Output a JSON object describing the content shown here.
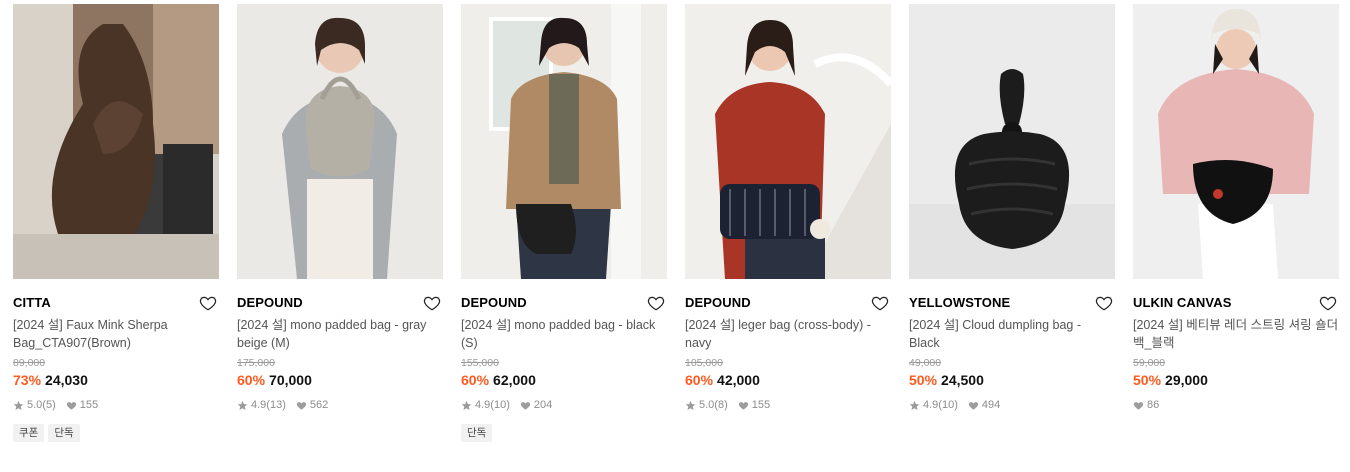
{
  "products": [
    {
      "brand": "CITTA",
      "title": "[2024 설] Faux Mink Sherpa Bag_CTA907(Brown)",
      "original_price": "89,000",
      "discount": "73%",
      "price": "24,030",
      "rating": "5.0",
      "review_count": "(5)",
      "likes": "155",
      "tags": [
        "쿠폰",
        "단독"
      ],
      "image": {
        "bg": "#c9b8a8",
        "accent": "#4a3426",
        "icon": "fur-bag-photo"
      }
    },
    {
      "brand": "DEPOUND",
      "title": "[2024 설] mono padded bag - gray beige (M)",
      "original_price": "175,000",
      "discount": "60%",
      "price": "70,000",
      "rating": "4.9",
      "review_count": "(13)",
      "likes": "562",
      "tags": [],
      "image": {
        "bg": "#e9e6e2",
        "accent": "#9a9a9a",
        "icon": "padded-bag-photo"
      }
    },
    {
      "brand": "DEPOUND",
      "title": "[2024 설] mono padded bag - black (S)",
      "original_price": "155,000",
      "discount": "60%",
      "price": "62,000",
      "rating": "4.9",
      "review_count": "(10)",
      "likes": "204",
      "tags": [
        "단독"
      ],
      "image": {
        "bg": "#ecebe8",
        "accent": "#b08a64",
        "icon": "padded-bag-photo"
      }
    },
    {
      "brand": "DEPOUND",
      "title": "[2024 설] leger bag (cross-body) - navy",
      "original_price": "105,000",
      "discount": "60%",
      "price": "42,000",
      "rating": "5.0",
      "review_count": "(8)",
      "likes": "155",
      "tags": [],
      "image": {
        "bg": "#f2f0ee",
        "accent": "#b23a2a",
        "icon": "crossbody-bag-photo"
      }
    },
    {
      "brand": "YELLOWSTONE",
      "title": "[2024 설] Cloud dumpling bag - Black",
      "original_price": "49,000",
      "discount": "50%",
      "price": "24,500",
      "rating": "4.9",
      "review_count": "(10)",
      "likes": "494",
      "tags": [],
      "image": {
        "bg": "#ededed",
        "accent": "#1c1c1c",
        "icon": "dumpling-bag-photo"
      }
    },
    {
      "brand": "ULKIN CANVAS",
      "title": "[2024 설] 베티뷰 레더 스트링 셔링 숄더백_블랙",
      "original_price": "59,000",
      "discount": "50%",
      "price": "29,000",
      "rating": "",
      "review_count": "",
      "likes": "86",
      "tags": [],
      "image": {
        "bg": "#eeeeee",
        "accent": "#e8b7b5",
        "icon": "shoulder-bag-photo"
      }
    }
  ]
}
